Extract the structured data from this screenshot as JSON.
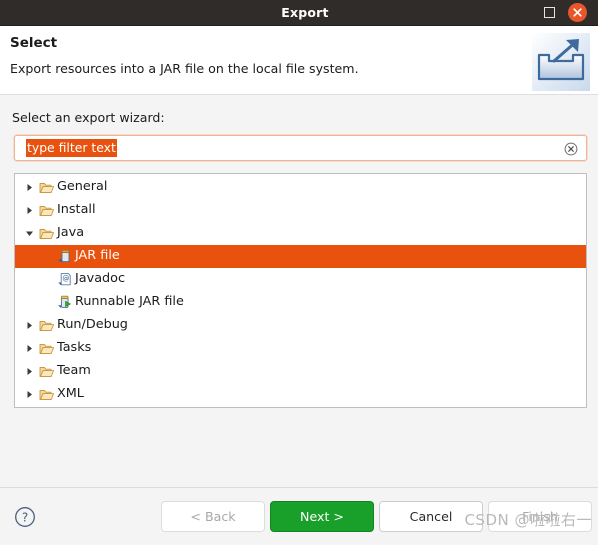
{
  "titlebar": {
    "title": "Export",
    "maximize_icon": "maximize-square-icon",
    "close_icon": "close-x-icon"
  },
  "header": {
    "title": "Select",
    "description": "Export resources into a JAR file on the local file system.",
    "icon": "export-tray-arrow-icon"
  },
  "wizard": {
    "label": "Select an export wizard:",
    "filter": {
      "value": "type filter text",
      "placeholder": "type filter text",
      "selected": true,
      "clear_icon": "clear-circle-x-icon",
      "highlight_color": "#e8520e"
    },
    "tree": [
      {
        "label": "General",
        "depth": 0,
        "expanded": false,
        "icon": "folder-icon",
        "selected": false
      },
      {
        "label": "Install",
        "depth": 0,
        "expanded": false,
        "icon": "folder-icon",
        "selected": false
      },
      {
        "label": "Java",
        "depth": 0,
        "expanded": true,
        "icon": "folder-icon",
        "selected": false
      },
      {
        "label": "JAR file",
        "depth": 1,
        "expanded": null,
        "icon": "jar-file-icon",
        "selected": true
      },
      {
        "label": "Javadoc",
        "depth": 1,
        "expanded": null,
        "icon": "javadoc-icon",
        "selected": false
      },
      {
        "label": "Runnable JAR file",
        "depth": 1,
        "expanded": null,
        "icon": "runnable-jar-icon",
        "selected": false
      },
      {
        "label": "Run/Debug",
        "depth": 0,
        "expanded": false,
        "icon": "folder-icon",
        "selected": false
      },
      {
        "label": "Tasks",
        "depth": 0,
        "expanded": false,
        "icon": "folder-icon",
        "selected": false
      },
      {
        "label": "Team",
        "depth": 0,
        "expanded": false,
        "icon": "folder-icon",
        "selected": false
      },
      {
        "label": "XML",
        "depth": 0,
        "expanded": false,
        "icon": "folder-icon",
        "selected": false
      }
    ]
  },
  "footer": {
    "help_icon": "help-question-icon",
    "buttons": [
      {
        "label": "< Back",
        "state": "disabled"
      },
      {
        "label": "Next >",
        "state": "primary"
      },
      {
        "label": "Cancel",
        "state": "normal"
      },
      {
        "label": "Finish",
        "state": "disabled"
      }
    ]
  },
  "watermark": {
    "text": "CSDN @啦啦右一"
  },
  "colors": {
    "selection": "#e8520e",
    "primary_button": "#18a02a",
    "titlebar": "#302c2a",
    "close_button": "#e9562a"
  }
}
